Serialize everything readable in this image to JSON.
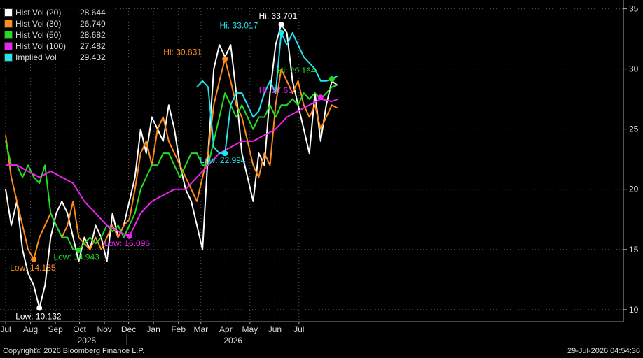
{
  "chart_data": {
    "type": "line",
    "x_start": "2024-07-01",
    "x_end": "2026-07-31",
    "ylim": [
      9,
      35.5
    ],
    "y_ticks": [
      10,
      15,
      20,
      25,
      30,
      35
    ],
    "grid": true,
    "legend_position": "top-left",
    "month_ticks": [
      {
        "label": "Jul",
        "date": "2024-07-01"
      },
      {
        "label": "Aug",
        "date": "2024-08-01"
      },
      {
        "label": "Sep",
        "date": "2024-09-01"
      },
      {
        "label": "Oct",
        "date": "2024-10-01"
      },
      {
        "label": "Nov",
        "date": "2024-11-01"
      },
      {
        "label": "Dec",
        "date": "2024-12-01"
      },
      {
        "label": "Jan",
        "date": "2025-01-01"
      },
      {
        "label": "Feb",
        "date": "2025-02-01"
      },
      {
        "label": "Mar",
        "date": "2025-03-01"
      },
      {
        "label": "Apr",
        "date": "2025-04-01"
      },
      {
        "label": "May",
        "date": "2025-05-01"
      },
      {
        "label": "Jun",
        "date": "2025-06-01"
      },
      {
        "label": "Jul",
        "date": "2025-07-01"
      }
    ],
    "year_labels": [
      {
        "label": "2025",
        "date": "2024-10-10"
      },
      {
        "label": "2026",
        "date": "2025-04-10"
      }
    ],
    "year_divider_date": "2025-01-01",
    "series": [
      {
        "name": "Hist Vol (20)",
        "value": "28.644",
        "color": "#ffffff",
        "points": [
          [
            "2024-07-01",
            20
          ],
          [
            "2024-07-08",
            17
          ],
          [
            "2024-07-15",
            19
          ],
          [
            "2024-07-22",
            15
          ],
          [
            "2024-07-29",
            13
          ],
          [
            "2024-08-05",
            12
          ],
          [
            "2024-08-12",
            10.132
          ],
          [
            "2024-08-19",
            12
          ],
          [
            "2024-08-26",
            16
          ],
          [
            "2024-09-02",
            18
          ],
          [
            "2024-09-09",
            19
          ],
          [
            "2024-09-16",
            18
          ],
          [
            "2024-09-23",
            16
          ],
          [
            "2024-09-30",
            14
          ],
          [
            "2024-10-07",
            16
          ],
          [
            "2024-10-14",
            15
          ],
          [
            "2024-10-21",
            17
          ],
          [
            "2024-10-28",
            16
          ],
          [
            "2024-11-04",
            14
          ],
          [
            "2024-11-11",
            18
          ],
          [
            "2024-11-18",
            16
          ],
          [
            "2024-11-25",
            17
          ],
          [
            "2024-12-02",
            19
          ],
          [
            "2024-12-09",
            21
          ],
          [
            "2024-12-16",
            25
          ],
          [
            "2024-12-23",
            23
          ],
          [
            "2024-12-30",
            26
          ],
          [
            "2025-01-06",
            25
          ],
          [
            "2025-01-13",
            24
          ],
          [
            "2025-01-20",
            27
          ],
          [
            "2025-01-27",
            25
          ],
          [
            "2025-02-03",
            22
          ],
          [
            "2025-02-10",
            20
          ],
          [
            "2025-02-17",
            19
          ],
          [
            "2025-02-24",
            17
          ],
          [
            "2025-03-03",
            15
          ],
          [
            "2025-03-10",
            23
          ],
          [
            "2025-03-17",
            30
          ],
          [
            "2025-03-24",
            32
          ],
          [
            "2025-03-31",
            31
          ],
          [
            "2025-04-07",
            32
          ],
          [
            "2025-04-14",
            28
          ],
          [
            "2025-04-21",
            23
          ],
          [
            "2025-04-28",
            21
          ],
          [
            "2025-05-05",
            19
          ],
          [
            "2025-05-12",
            23
          ],
          [
            "2025-05-19",
            22
          ],
          [
            "2025-05-26",
            28
          ],
          [
            "2025-06-02",
            32
          ],
          [
            "2025-06-09",
            33.701
          ],
          [
            "2025-06-16",
            33
          ],
          [
            "2025-06-23",
            29
          ],
          [
            "2025-06-30",
            27
          ],
          [
            "2025-07-07",
            25
          ],
          [
            "2025-07-14",
            23
          ],
          [
            "2025-07-21",
            28
          ],
          [
            "2025-07-28",
            24
          ],
          [
            "2025-08-04",
            27
          ],
          [
            "2025-08-11",
            29
          ],
          [
            "2025-08-18",
            28.644
          ]
        ]
      },
      {
        "name": "Hist Vol (30)",
        "value": "26.749",
        "color": "#ff8c1a",
        "points": [
          [
            "2024-07-01",
            24.5
          ],
          [
            "2024-07-08",
            21
          ],
          [
            "2024-07-15",
            19
          ],
          [
            "2024-07-22",
            17
          ],
          [
            "2024-07-29",
            15
          ],
          [
            "2024-08-05",
            14.185
          ],
          [
            "2024-08-12",
            16
          ],
          [
            "2024-08-19",
            17
          ],
          [
            "2024-08-26",
            18
          ],
          [
            "2024-09-02",
            17
          ],
          [
            "2024-09-09",
            16
          ],
          [
            "2024-09-16",
            17
          ],
          [
            "2024-09-23",
            19
          ],
          [
            "2024-09-30",
            16
          ],
          [
            "2024-10-07",
            15.5
          ],
          [
            "2024-10-14",
            15
          ],
          [
            "2024-10-21",
            16
          ],
          [
            "2024-10-28",
            15
          ],
          [
            "2024-11-04",
            16
          ],
          [
            "2024-11-11",
            17
          ],
          [
            "2024-11-18",
            16
          ],
          [
            "2024-11-25",
            17
          ],
          [
            "2024-12-02",
            17.5
          ],
          [
            "2024-12-09",
            20
          ],
          [
            "2024-12-16",
            23
          ],
          [
            "2024-12-23",
            24
          ],
          [
            "2024-12-30",
            22
          ],
          [
            "2025-01-06",
            25
          ],
          [
            "2025-01-13",
            26
          ],
          [
            "2025-01-20",
            24
          ],
          [
            "2025-01-27",
            23
          ],
          [
            "2025-02-03",
            22
          ],
          [
            "2025-02-10",
            21
          ],
          [
            "2025-02-17",
            20
          ],
          [
            "2025-02-24",
            19
          ],
          [
            "2025-03-03",
            21
          ],
          [
            "2025-03-10",
            23
          ],
          [
            "2025-03-17",
            27
          ],
          [
            "2025-03-24",
            29
          ],
          [
            "2025-03-31",
            30.831
          ],
          [
            "2025-04-07",
            29
          ],
          [
            "2025-04-14",
            27
          ],
          [
            "2025-04-21",
            26
          ],
          [
            "2025-04-28",
            24
          ],
          [
            "2025-05-05",
            22
          ],
          [
            "2025-05-12",
            21
          ],
          [
            "2025-05-19",
            23
          ],
          [
            "2025-05-26",
            22
          ],
          [
            "2025-06-02",
            27
          ],
          [
            "2025-06-09",
            30
          ],
          [
            "2025-06-16",
            29
          ],
          [
            "2025-06-23",
            28
          ],
          [
            "2025-06-30",
            29
          ],
          [
            "2025-07-07",
            27
          ],
          [
            "2025-07-14",
            26
          ],
          [
            "2025-07-21",
            27
          ],
          [
            "2025-07-28",
            25
          ],
          [
            "2025-08-04",
            26
          ],
          [
            "2025-08-11",
            27
          ],
          [
            "2025-08-18",
            26.749
          ]
        ]
      },
      {
        "name": "Hist Vol (50)",
        "value": "28.682",
        "color": "#22dd22",
        "points": [
          [
            "2024-07-01",
            24
          ],
          [
            "2024-07-08",
            22
          ],
          [
            "2024-07-15",
            22
          ],
          [
            "2024-07-22",
            21
          ],
          [
            "2024-07-29",
            22
          ],
          [
            "2024-08-05",
            21
          ],
          [
            "2024-08-12",
            20.5
          ],
          [
            "2024-08-19",
            22
          ],
          [
            "2024-08-26",
            18
          ],
          [
            "2024-09-02",
            17
          ],
          [
            "2024-09-09",
            16
          ],
          [
            "2024-09-16",
            16
          ],
          [
            "2024-09-23",
            15
          ],
          [
            "2024-09-30",
            14.943
          ],
          [
            "2024-10-07",
            15.5
          ],
          [
            "2024-10-14",
            16
          ],
          [
            "2024-10-21",
            15.5
          ],
          [
            "2024-10-28",
            16
          ],
          [
            "2024-11-04",
            17
          ],
          [
            "2024-11-11",
            16.5
          ],
          [
            "2024-11-18",
            17
          ],
          [
            "2024-11-25",
            16
          ],
          [
            "2024-12-02",
            17
          ],
          [
            "2024-12-09",
            18
          ],
          [
            "2024-12-16",
            20
          ],
          [
            "2024-12-23",
            21
          ],
          [
            "2024-12-30",
            22
          ],
          [
            "2025-01-06",
            22
          ],
          [
            "2025-01-13",
            23
          ],
          [
            "2025-01-20",
            23
          ],
          [
            "2025-01-27",
            22
          ],
          [
            "2025-02-03",
            21
          ],
          [
            "2025-02-10",
            22
          ],
          [
            "2025-02-17",
            23
          ],
          [
            "2025-02-24",
            23
          ],
          [
            "2025-03-03",
            22
          ],
          [
            "2025-03-10",
            22
          ],
          [
            "2025-03-17",
            24
          ],
          [
            "2025-03-24",
            26
          ],
          [
            "2025-03-31",
            28
          ],
          [
            "2025-04-07",
            27
          ],
          [
            "2025-04-14",
            26
          ],
          [
            "2025-04-21",
            27
          ],
          [
            "2025-04-28",
            26
          ],
          [
            "2025-05-05",
            25
          ],
          [
            "2025-05-12",
            26
          ],
          [
            "2025-05-19",
            26
          ],
          [
            "2025-05-26",
            27
          ],
          [
            "2025-06-02",
            26
          ],
          [
            "2025-06-09",
            27
          ],
          [
            "2025-06-16",
            27
          ],
          [
            "2025-06-23",
            27.5
          ],
          [
            "2025-06-30",
            27
          ],
          [
            "2025-07-07",
            28
          ],
          [
            "2025-07-14",
            27.5
          ],
          [
            "2025-07-21",
            28
          ],
          [
            "2025-07-28",
            27.5
          ],
          [
            "2025-08-04",
            28
          ],
          [
            "2025-08-11",
            28.5
          ],
          [
            "2025-08-18",
            28.682
          ]
        ]
      },
      {
        "name": "Hist Vol (100)",
        "value": "27.482",
        "color": "#ee22ee",
        "points": [
          [
            "2024-07-01",
            22
          ],
          [
            "2024-07-15",
            22
          ],
          [
            "2024-07-29",
            21.5
          ],
          [
            "2024-08-12",
            21
          ],
          [
            "2024-08-26",
            21.5
          ],
          [
            "2024-09-09",
            21
          ],
          [
            "2024-09-23",
            20.5
          ],
          [
            "2024-10-07",
            19
          ],
          [
            "2024-10-21",
            18
          ],
          [
            "2024-11-04",
            17
          ],
          [
            "2024-11-18",
            16.5
          ],
          [
            "2024-12-02",
            16.096
          ],
          [
            "2024-12-16",
            18
          ],
          [
            "2024-12-30",
            19
          ],
          [
            "2025-01-13",
            19.5
          ],
          [
            "2025-01-27",
            20
          ],
          [
            "2025-02-10",
            20
          ],
          [
            "2025-02-24",
            21
          ],
          [
            "2025-03-10",
            22
          ],
          [
            "2025-03-24",
            23
          ],
          [
            "2025-04-07",
            23.5
          ],
          [
            "2025-04-21",
            24
          ],
          [
            "2025-05-05",
            24
          ],
          [
            "2025-05-19",
            24.5
          ],
          [
            "2025-06-02",
            25
          ],
          [
            "2025-06-16",
            26
          ],
          [
            "2025-06-30",
            26.5
          ],
          [
            "2025-07-14",
            27
          ],
          [
            "2025-07-28",
            27.5
          ],
          [
            "2025-08-11",
            27.3
          ],
          [
            "2025-08-18",
            27.482
          ]
        ]
      },
      {
        "name": "Implied Vol",
        "value": "29.432",
        "color": "#22e5ee",
        "points": [
          [
            "2025-02-24",
            28.5
          ],
          [
            "2025-03-03",
            29
          ],
          [
            "2025-03-10",
            28.5
          ],
          [
            "2025-03-17",
            23.5
          ],
          [
            "2025-03-24",
            23
          ],
          [
            "2025-03-31",
            22.994
          ],
          [
            "2025-04-07",
            27
          ],
          [
            "2025-04-14",
            28
          ],
          [
            "2025-04-21",
            28
          ],
          [
            "2025-04-28",
            27
          ],
          [
            "2025-05-05",
            26
          ],
          [
            "2025-05-12",
            26.5
          ],
          [
            "2025-05-19",
            28
          ],
          [
            "2025-05-26",
            29
          ],
          [
            "2025-06-02",
            28
          ],
          [
            "2025-06-09",
            33.017
          ],
          [
            "2025-06-16",
            32
          ],
          [
            "2025-06-23",
            33
          ],
          [
            "2025-06-30",
            32
          ],
          [
            "2025-07-07",
            31
          ],
          [
            "2025-07-14",
            30.5
          ],
          [
            "2025-07-21",
            30
          ],
          [
            "2025-07-28",
            29
          ],
          [
            "2025-08-04",
            29
          ],
          [
            "2025-08-11",
            29.164
          ],
          [
            "2025-08-18",
            29.432
          ]
        ]
      }
    ],
    "annotations": [
      {
        "text": "Hi: 33.701",
        "date": "2025-06-09",
        "value": 33.701,
        "color": "#ffffff",
        "pos": "above"
      },
      {
        "text": "Hi: 33.017",
        "date": "2025-06-09",
        "value": 33.017,
        "color": "#22e5ee",
        "pos": "left"
      },
      {
        "text": "Hi: 30.831",
        "date": "2025-03-31",
        "value": 30.831,
        "color": "#ff8c1a",
        "pos": "left"
      },
      {
        "text": "Hi: 29.164",
        "date": "2025-08-11",
        "value": 29.164,
        "color": "#22dd22",
        "pos": "above-left"
      },
      {
        "text": "Hi: 27.65",
        "date": "2025-07-28",
        "value": 27.65,
        "color": "#ee22ee",
        "pos": "left"
      },
      {
        "text": "Low: 22.994",
        "date": "2025-03-31",
        "value": 22.994,
        "color": "#22e5ee",
        "pos": "below-left"
      },
      {
        "text": "Low: 16.096",
        "date": "2024-12-02",
        "value": 16.096,
        "color": "#ee22ee",
        "pos": "below-left"
      },
      {
        "text": "Low: 14.943",
        "date": "2024-09-30",
        "value": 14.943,
        "color": "#22dd22",
        "pos": "below-left"
      },
      {
        "text": "Low: 14.185",
        "date": "2024-08-05",
        "value": 14.185,
        "color": "#ff8c1a",
        "pos": "below"
      },
      {
        "text": "Low: 10.132",
        "date": "2024-08-12",
        "value": 10.132,
        "color": "#ffffff",
        "pos": "below"
      }
    ]
  },
  "footer": {
    "copyright": "Copyright© 2026 Bloomberg Finance L.P.",
    "timestamp": "29-Jul-2026 04:54:36"
  }
}
